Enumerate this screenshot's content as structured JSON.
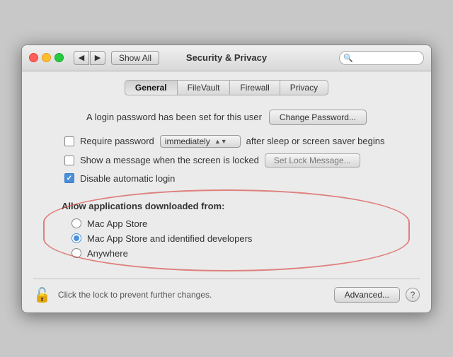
{
  "window": {
    "title": "Security & Privacy",
    "search_placeholder": ""
  },
  "titlebar": {
    "show_all": "Show All",
    "back_arrow": "◀",
    "forward_arrow": "▶"
  },
  "tabs": [
    {
      "id": "general",
      "label": "General",
      "active": true
    },
    {
      "id": "filevault",
      "label": "FileVault",
      "active": false
    },
    {
      "id": "firewall",
      "label": "Firewall",
      "active": false
    },
    {
      "id": "privacy",
      "label": "Privacy",
      "active": false
    }
  ],
  "content": {
    "login_password_label": "A login password has been set for this user",
    "change_password_btn": "Change Password...",
    "require_password_label": "Require password",
    "require_password_checked": false,
    "immediately_value": "immediately",
    "after_sleep_label": "after sleep or screen saver begins",
    "show_message_label": "Show a message when the screen is locked",
    "show_message_checked": false,
    "set_lock_message_btn": "Set Lock Message...",
    "disable_auto_login_label": "Disable automatic login",
    "disable_auto_login_checked": true,
    "gatekeeper_heading": "Allow applications downloaded from:",
    "radio_options": [
      {
        "id": "mac_app_store",
        "label": "Mac App Store",
        "selected": false
      },
      {
        "id": "mac_app_store_identified",
        "label": "Mac App Store and identified developers",
        "selected": true
      },
      {
        "id": "anywhere",
        "label": "Anywhere",
        "selected": false
      }
    ]
  },
  "footer": {
    "lock_label": "Click the lock to prevent further changes.",
    "advanced_btn": "Advanced...",
    "help_label": "?"
  }
}
